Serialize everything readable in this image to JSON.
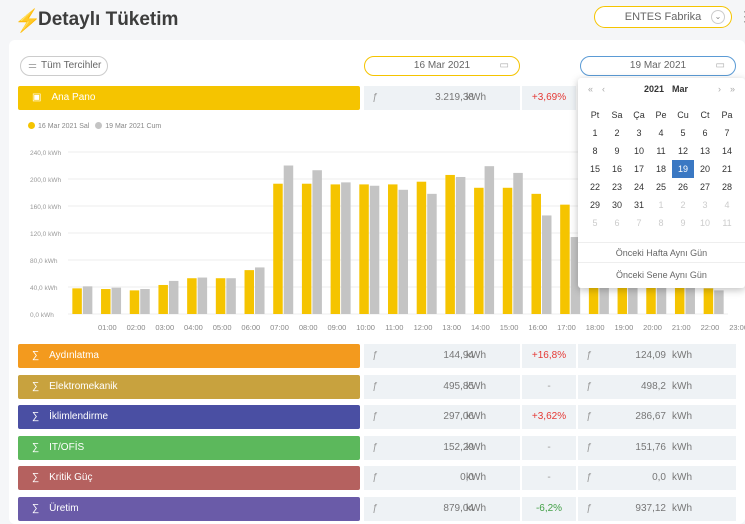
{
  "header": {
    "title": "Detaylı Tüketim",
    "factory": "ENTES Fabrika"
  },
  "toolbar": {
    "preferences_label": "Tüm Tercihler",
    "date1": "16 Mar 2021",
    "date2": "19 Mar 2021"
  },
  "main_row": {
    "label": "Ana Pano",
    "value1": "3.219,38",
    "unit": "kWh",
    "change": "+3,69%"
  },
  "legend": {
    "series1": "16 Mar 2021 Sal",
    "series2": "19 Mar 2021 Cum"
  },
  "chart_data": {
    "type": "bar",
    "categories": [
      "01:00",
      "02:00",
      "03:00",
      "04:00",
      "05:00",
      "06:00",
      "07:00",
      "08:00",
      "09:00",
      "10:00",
      "11:00",
      "12:00",
      "13:00",
      "14:00",
      "15:00",
      "16:00",
      "17:00",
      "18:00",
      "19:00",
      "20:00",
      "21:00",
      "22:00",
      "23:00"
    ],
    "series": [
      {
        "name": "16 Mar 2021 Sal",
        "values": [
          38,
          37,
          35,
          43,
          53,
          53,
          65,
          193,
          193,
          192,
          192,
          192,
          196,
          206,
          187,
          187,
          178,
          162,
          160,
          150,
          105,
          95,
          38
        ]
      },
      {
        "name": "19 Mar 2021 Cum",
        "values": [
          41,
          39,
          37,
          49,
          54,
          53,
          69,
          220,
          213,
          195,
          190,
          184,
          178,
          203,
          219,
          209,
          146,
          114,
          135,
          140,
          95,
          85,
          35
        ]
      }
    ],
    "yticks": [
      "0,0 kWh",
      "40,0 kWh",
      "80,0 kWh",
      "120,0 kWh",
      "160,0 kWh",
      "200,0 kWh",
      "240,0 kWh"
    ],
    "ylim": [
      0,
      240
    ],
    "colors": [
      "#f5c400",
      "#c4c4c4"
    ]
  },
  "rows": [
    {
      "label": "Aydınlatma",
      "color": "#f39a1e",
      "value1": "144,94",
      "change": "+16,8%",
      "change_color": "#e53935",
      "value2": "124,09"
    },
    {
      "label": "Elektromekanik",
      "color": "#c8a23e",
      "value1": "495,85",
      "change": "-",
      "change_color": "#999999",
      "value2": "498,2"
    },
    {
      "label": "İklimlendirme",
      "color": "#4a4fa3",
      "value1": "297,06",
      "change": "+3,62%",
      "change_color": "#e53935",
      "value2": "286,67"
    },
    {
      "label": "IT/OFİS",
      "color": "#5cb85c",
      "value1": "152,29",
      "change": "-",
      "change_color": "#999999",
      "value2": "151,76"
    },
    {
      "label": "Kritik Güç",
      "color": "#b5615f",
      "value1": "0,0",
      "change": "-",
      "change_color": "#999999",
      "value2": "0,0"
    },
    {
      "label": "Üretim",
      "color": "#6a5ba8",
      "value1": "879,04",
      "change": "-6,2%",
      "change_color": "#43a047",
      "value2": "937,12"
    }
  ],
  "row_unit": "kWh",
  "calendar": {
    "year": "2021",
    "month": "Mar",
    "prev_year": "«",
    "prev_month": "‹",
    "next_month": "›",
    "next_year": "»",
    "weekdays": [
      "Pt",
      "Sa",
      "Ça",
      "Pe",
      "Cu",
      "Ct",
      "Pa"
    ],
    "days": [
      [
        "1",
        "2",
        "3",
        "4",
        "5",
        "6",
        "7"
      ],
      [
        "8",
        "9",
        "10",
        "11",
        "12",
        "13",
        "14"
      ],
      [
        "15",
        "16",
        "17",
        "18",
        "19",
        "20",
        "21"
      ],
      [
        "22",
        "23",
        "24",
        "25",
        "26",
        "27",
        "28"
      ],
      [
        "29",
        "30",
        "31",
        "1",
        "2",
        "3",
        "4"
      ],
      [
        "5",
        "6",
        "7",
        "8",
        "9",
        "10",
        "11"
      ]
    ],
    "selected": "19",
    "btn_week": "Önceki Hafta Aynı Gün",
    "btn_year": "Önceki Sene Aynı Gün"
  }
}
